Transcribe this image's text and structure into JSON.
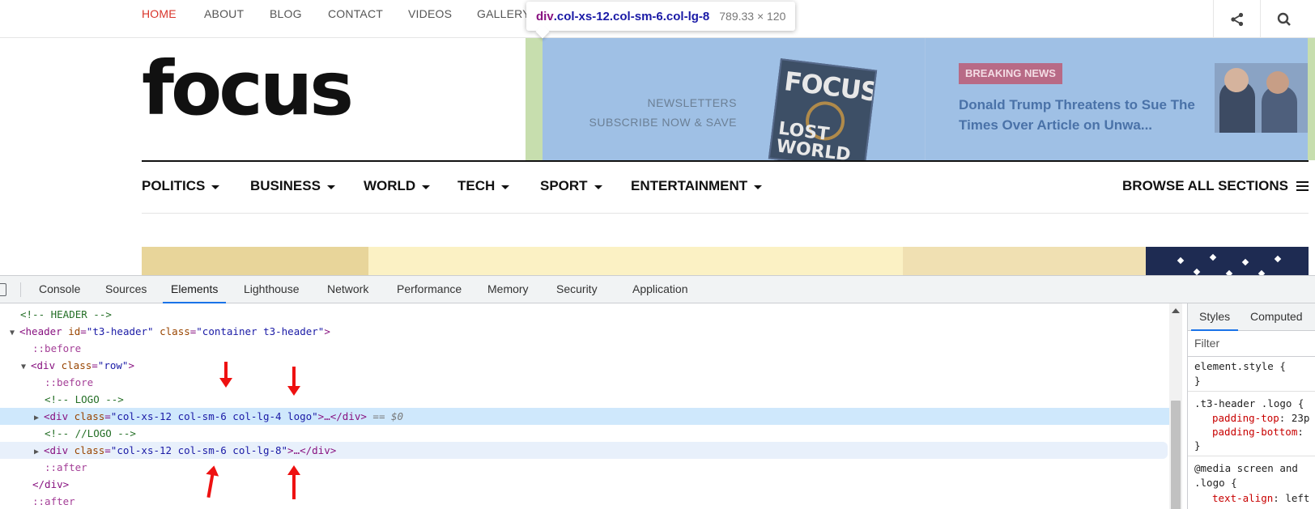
{
  "site": {
    "top_nav": [
      {
        "label": "HOME",
        "active": true
      },
      {
        "label": "ABOUT"
      },
      {
        "label": "BLOG"
      },
      {
        "label": "CONTACT"
      },
      {
        "label": "VIDEOS"
      },
      {
        "label": "GALLERY"
      }
    ],
    "top_icons": [
      "share-icon",
      "search-icon"
    ],
    "tooltip": {
      "selector_tag": "div",
      "selector_classes": ".col-xs-12.col-sm-6.col-lg-8",
      "dimensions": "789.33 × 120"
    },
    "logo": "focus",
    "newsletter": {
      "line1": "NEWSLETTERS",
      "line2": "SUBSCRIBE NOW & SAVE"
    },
    "magazine": {
      "title": "FOCUS",
      "cover_text": "LOST WORLD"
    },
    "breaking": {
      "badge": "BREAKING NEWS",
      "headline": "Donald Trump Threatens to Sue The Times Over Article on Unwa..."
    },
    "main_nav": [
      "POLITICS",
      "BUSINESS",
      "WORLD",
      "TECH",
      "SPORT",
      "ENTERTAINMENT"
    ],
    "browse_all": "BROWSE ALL SECTIONS",
    "colors": {
      "accent": "#d9352b",
      "highlight_content": "#9fc0e5",
      "highlight_padding": "#c7deae"
    }
  },
  "devtools": {
    "tabs": [
      "Console",
      "Sources",
      "Elements",
      "Lighthouse",
      "Network",
      "Performance",
      "Memory",
      "Security",
      "Application"
    ],
    "active_tab": "Elements",
    "dom": {
      "l1": "<!-- HEADER -->",
      "l2_tag_open": "<header",
      "l2_attr1_name": " id",
      "l2_attr1_val": "\"t3-header\"",
      "l2_attr2_name": " class",
      "l2_attr2_val": "\"container t3-header\"",
      "l2_tag_close": ">",
      "l3": "::before",
      "l4_tag_open": "<div",
      "l4_attr_name": " class",
      "l4_attr_val": "\"row\"",
      "l4_tag_close": ">",
      "l5": "::before",
      "l6": "<!-- LOGO -->",
      "l7_tag_open": "<div",
      "l7_attr_name": " class",
      "l7_attr_val": "\"col-xs-12 col-sm-6 col-lg-4 logo\"",
      "l7_tag_close": ">…</div>",
      "l7_eq": " == $0",
      "l8": "<!-- //LOGO -->",
      "l9_tag_open": "<div",
      "l9_attr_name": " class",
      "l9_attr_val": "\"col-xs-12 col-sm-6 col-lg-8\"",
      "l9_tag_close": ">…</div>",
      "l10": "::after",
      "l11": "</div>",
      "l12": "::after"
    },
    "styles_tabs": [
      "Styles",
      "Computed"
    ],
    "filter_placeholder": "Filter",
    "css": {
      "r1_sel": "element.style {",
      "r1_end": "}",
      "r2_sel": ".t3-header .logo {",
      "r2_p1": "padding-top",
      "r2_v1": ": 23p",
      "r2_p2": "padding-bottom",
      "r2_v2": ":",
      "r2_end": "}",
      "r3_sel": "@media screen and",
      "r3_sel2": ".logo {",
      "r3_p1": "text-align",
      "r3_v1": ": left"
    }
  }
}
